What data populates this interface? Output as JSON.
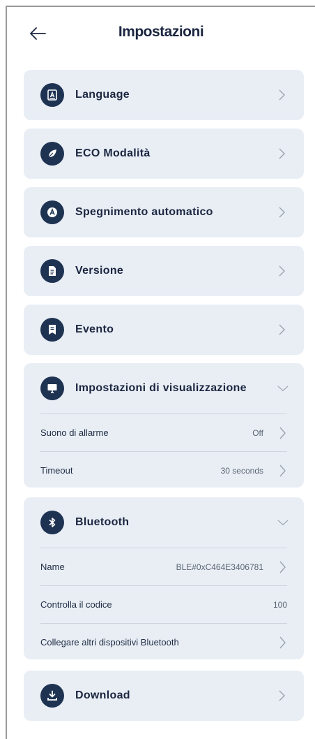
{
  "header": {
    "title": "Impostazioni"
  },
  "items": [
    {
      "label": "Language"
    },
    {
      "label": "ECO Modalità"
    },
    {
      "label": "Spegnimento automatico"
    },
    {
      "label": "Versione"
    },
    {
      "label": "Evento"
    }
  ],
  "display_settings": {
    "label": "Impostazioni di visualizzazione",
    "rows": [
      {
        "label": "Suono di allarme",
        "value": "Off"
      },
      {
        "label": "Timeout",
        "value": "30 seconds"
      }
    ]
  },
  "bluetooth": {
    "label": "Bluetooth",
    "rows": [
      {
        "label": "Name",
        "value": "BLE#0xC464E3406781"
      },
      {
        "label": "Controlla il codice",
        "value": "100"
      },
      {
        "label": "Collegare altri dispositivi Bluetooth",
        "value": ""
      }
    ]
  },
  "download": {
    "label": "Download"
  },
  "colors": {
    "accent": "#1e3352",
    "card_bg": "#e9eef5",
    "divider": "#cdd4de"
  },
  "icons": [
    "back-arrow-icon",
    "language-icon",
    "leaf-icon",
    "auto-off-icon",
    "document-icon",
    "event-icon",
    "display-icon",
    "bluetooth-icon",
    "download-icon",
    "chevron-right-icon",
    "chevron-down-icon"
  ]
}
